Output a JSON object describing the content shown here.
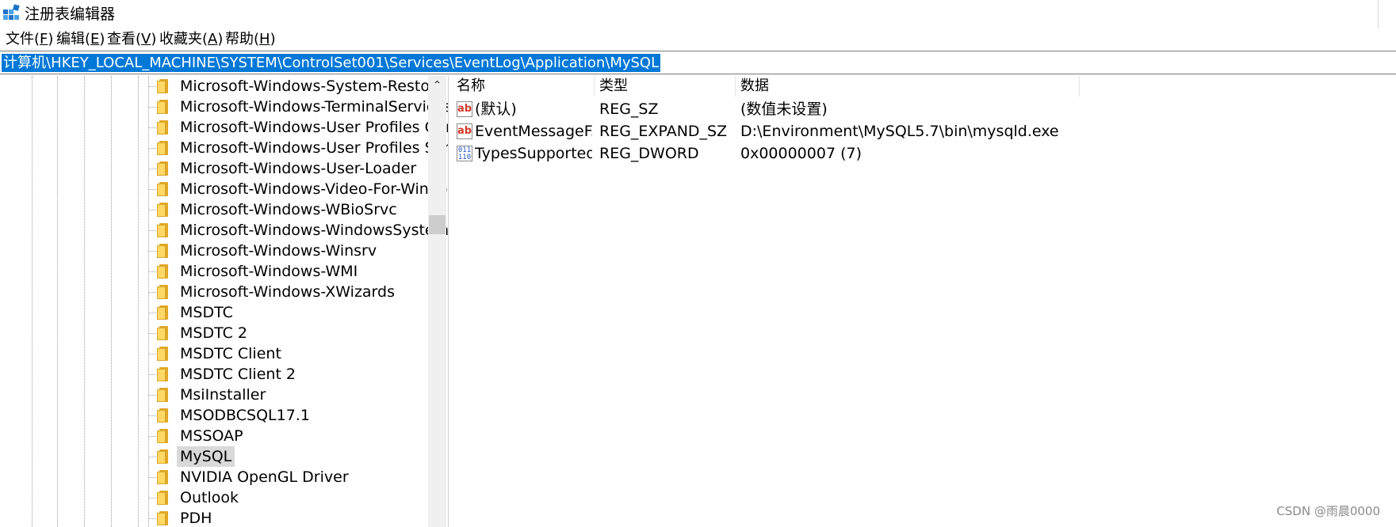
{
  "window": {
    "title": "注册表编辑器"
  },
  "menu": [
    {
      "label": "文件(",
      "key": "F",
      "end": ")"
    },
    {
      "label": "编辑(",
      "key": "E",
      "end": ")"
    },
    {
      "label": "查看(",
      "key": "V",
      "end": ")"
    },
    {
      "label": "收藏夹(",
      "key": "A",
      "end": ")"
    },
    {
      "label": "帮助(",
      "key": "H",
      "end": ")"
    }
  ],
  "address": {
    "path": "计算机\\HKEY_LOCAL_MACHINE\\SYSTEM\\ControlSet001\\Services\\EventLog\\Application\\MySQL"
  },
  "tree": {
    "items": [
      "Microsoft-Windows-System-Restore",
      "Microsoft-Windows-TerminalServices",
      "Microsoft-Windows-User Profiles General",
      "Microsoft-Windows-User Profiles Service",
      "Microsoft-Windows-User-Loader",
      "Microsoft-Windows-Video-For-Windows",
      "Microsoft-Windows-WBioSrvc",
      "Microsoft-Windows-WindowsSystemAssessmentTool",
      "Microsoft-Windows-Winsrv",
      "Microsoft-Windows-WMI",
      "Microsoft-Windows-XWizards",
      "MSDTC",
      "MSDTC 2",
      "MSDTC Client",
      "MSDTC Client 2",
      "MsiInstaller",
      "MSODBCSQL17.1",
      "MSSOAP",
      "MySQL",
      "NVIDIA OpenGL Driver",
      "Outlook",
      "PDH"
    ],
    "selected": "MySQL"
  },
  "list": {
    "columns": [
      "名称",
      "类型",
      "数据"
    ],
    "rows": [
      {
        "name": "(默认)",
        "type": "REG_SZ",
        "data": "(数值未设置)",
        "icon": "string-value-icon"
      },
      {
        "name": "EventMessageF...",
        "type": "REG_EXPAND_SZ",
        "data": "D:\\Environment\\MySQL5.7\\bin\\mysqld.exe",
        "icon": "string-value-icon"
      },
      {
        "name": "TypesSupported",
        "type": "REG_DWORD",
        "data": "0x00000007 (7)",
        "icon": "binary-value-icon"
      }
    ]
  },
  "watermark": "CSDN @雨晨0000",
  "colors": {
    "selection": "#0078d7",
    "tree_selected": "#d9d9d9",
    "folder": "#ffd866"
  }
}
